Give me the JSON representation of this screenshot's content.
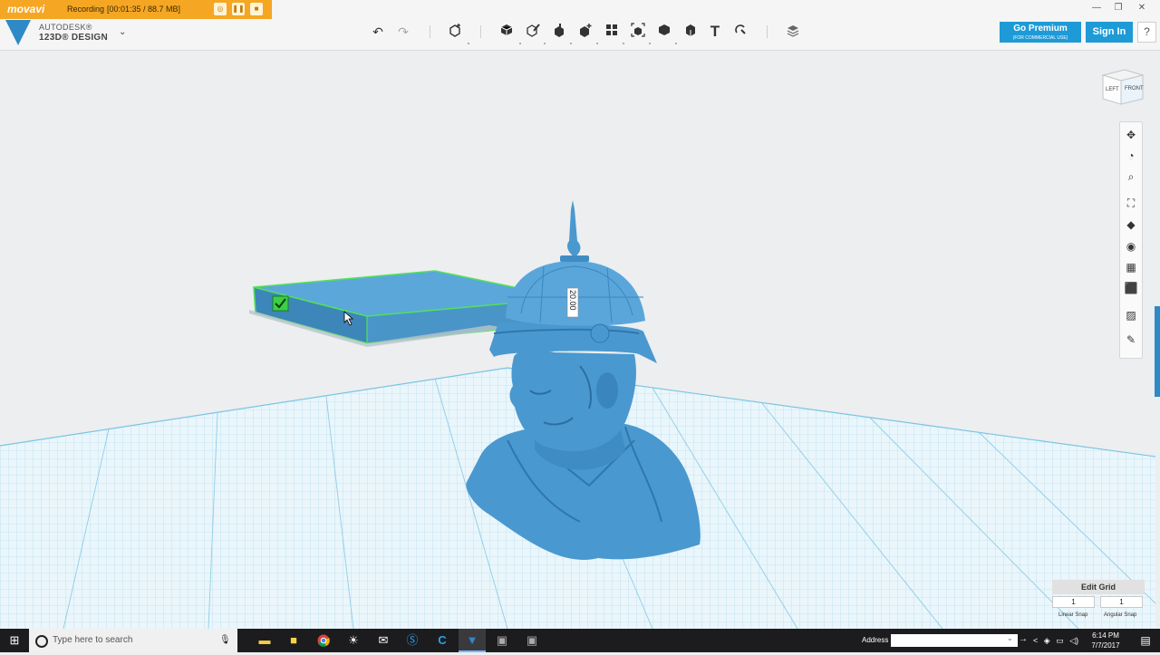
{
  "recorder": {
    "brand": "movavi",
    "status_label": "Recording",
    "stats": "[00:01:35 / 88.7 MB]"
  },
  "app": {
    "vendor": "AUTODESK®",
    "product": "123D® DESIGN"
  },
  "toolbar": {
    "undo_icon": "undo-icon",
    "redo_icon": "redo-icon",
    "tools": [
      "transform",
      "primitives",
      "sketch",
      "construct",
      "modify",
      "pattern",
      "grouping",
      "combine",
      "measure",
      "text",
      "snap"
    ],
    "text_tool_glyph": "T"
  },
  "header": {
    "premium_label": "Go Premium",
    "premium_sub": "(FOR COMMERCIAL USE)",
    "signin_label": "Sign In",
    "help_label": "?"
  },
  "viewcube": {
    "left": "LEFT",
    "front": "FRONT"
  },
  "dimension": {
    "value": "20.00"
  },
  "grid_editor": {
    "title": "Edit Grid",
    "linear_snap_value": "1",
    "linear_snap_label": "Linear Snap",
    "angular_snap_value": "1",
    "angular_snap_label": "Angular Snap"
  },
  "taskbar": {
    "search_placeholder": "Type here to search",
    "address_label": "Address",
    "time": "6:14 PM",
    "date": "7/7/2017",
    "apps": [
      "file-explorer",
      "sticky-notes",
      "chrome",
      "brightness",
      "mail",
      "skype",
      "ccleaner",
      "123d-design",
      "media-player",
      "video-editor"
    ]
  },
  "colors": {
    "model": "#4a98d0",
    "grid": "#bfe4f2",
    "accent": "#1e9ad6",
    "recorder": "#f5a623",
    "selection": "#52e05a"
  }
}
